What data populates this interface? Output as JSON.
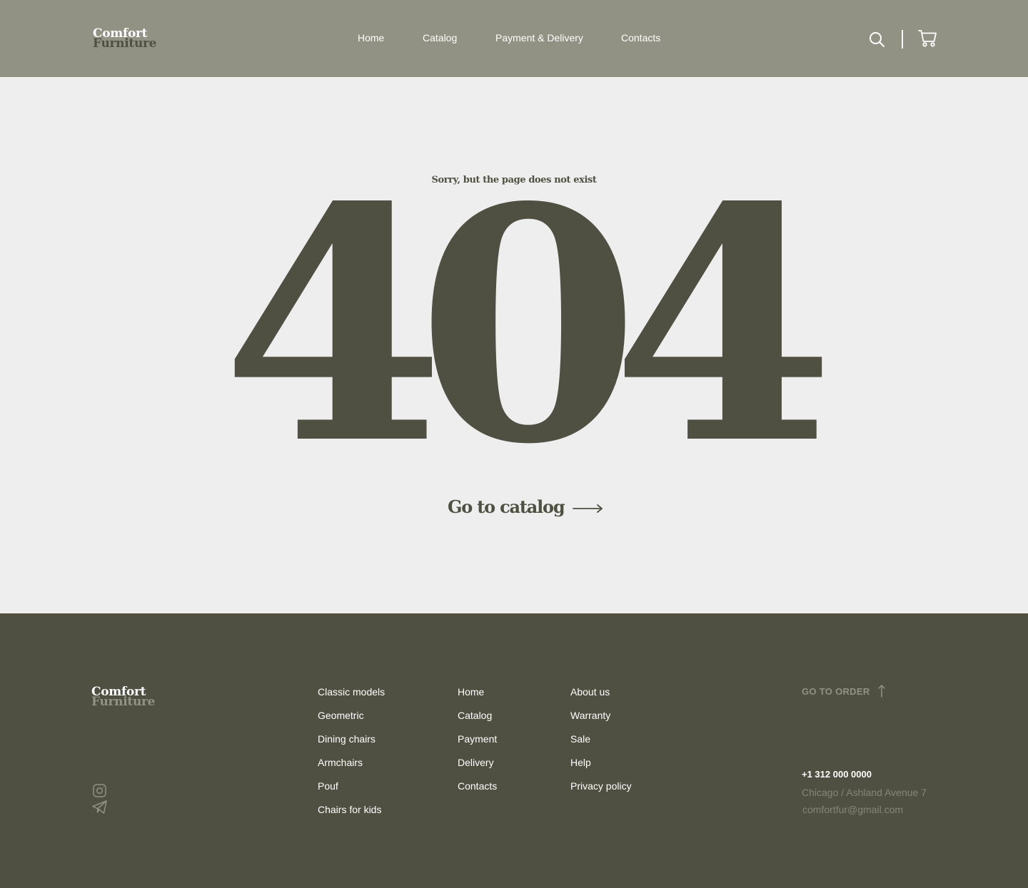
{
  "header": {
    "logo": {
      "line1": "Comfort",
      "line2": "Furniture"
    },
    "nav": [
      {
        "label": "Home"
      },
      {
        "label": "Catalog"
      },
      {
        "label": "Payment & Delivery"
      },
      {
        "label": "Contacts"
      }
    ],
    "icons": {
      "search": "search-icon",
      "cart": "cart-icon"
    }
  },
  "main": {
    "message": "Sorry, but the page does not exist",
    "code": "404",
    "cta_label": "Go to catalog"
  },
  "footer": {
    "logo": {
      "line1": "Comfort",
      "line2": "Furniture"
    },
    "social": [
      "instagram-icon",
      "telegram-icon"
    ],
    "col1": [
      "Classic models",
      "Geometric",
      "Dining chairs",
      "Armchairs",
      "Pouf",
      "Chairs for kids"
    ],
    "col2": [
      "Home",
      "Catalog",
      "Payment",
      "Delivery",
      "Contacts"
    ],
    "col3": [
      "About us",
      "Warranty",
      "Sale",
      "Help",
      "Privacy policy"
    ],
    "go_order": "GO TO ORDER",
    "phone": "+1 312 000 0000",
    "address": "Chicago / Ashland Avenue 7",
    "email": "comfortfur@gmail.com"
  },
  "colors": {
    "header_bg": "#919283",
    "page_bg": "#eeeeee",
    "accent_dark": "#4f5042",
    "muted_text": "#858678",
    "white": "#ffffff"
  }
}
